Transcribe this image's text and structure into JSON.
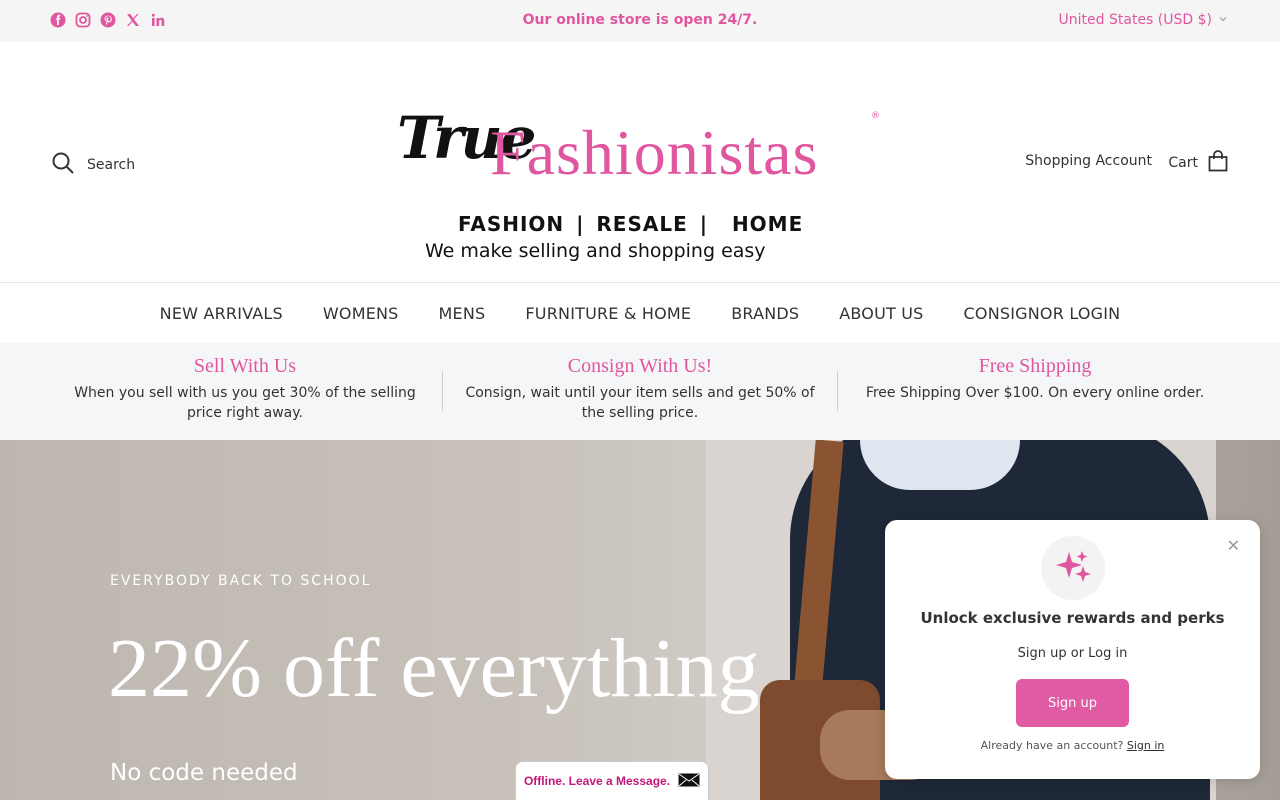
{
  "topbar": {
    "announcement": "Our online store is open 24/7.",
    "currency": "United States (USD $)",
    "social": [
      "facebook-icon",
      "instagram-icon",
      "pinterest-icon",
      "x-icon",
      "linkedin-icon"
    ]
  },
  "header": {
    "search_label": "Search",
    "logo": {
      "script": "True",
      "brand": "Fashionistas",
      "reg": "®",
      "tagline1": "FASHION | RESALE |  HOME",
      "tagline2": "We make selling and shopping easy"
    },
    "account_label": "Shopping Account",
    "cart_label": "Cart"
  },
  "nav": {
    "items": [
      "NEW ARRIVALS",
      "WOMENS",
      "MENS",
      "FURNITURE & HOME",
      "BRANDS",
      "ABOUT US",
      "CONSIGNOR LOGIN"
    ]
  },
  "usp": [
    {
      "title": "Sell With Us",
      "desc": "When you sell with us you get 30% of the selling price right away."
    },
    {
      "title": "Consign With Us!",
      "desc": "Consign, wait until your item sells and get 50% of the selling price."
    },
    {
      "title": "Free Shipping",
      "desc": "Free Shipping Over $100. On every online order."
    }
  ],
  "hero": {
    "eyebrow": "EVERYBODY BACK TO SCHOOL",
    "headline": "22% off everything",
    "sub": "No code needed"
  },
  "chat": {
    "label": "Offline. Leave a Message."
  },
  "popup": {
    "title": "Unlock exclusive rewards and perks",
    "sub": "Sign up or Log in",
    "signup_label": "Sign up",
    "already_text": "Already have an account?",
    "signin_label": "Sign in"
  },
  "colors": {
    "accent": "#e0569f",
    "button": "#e05aa4"
  }
}
